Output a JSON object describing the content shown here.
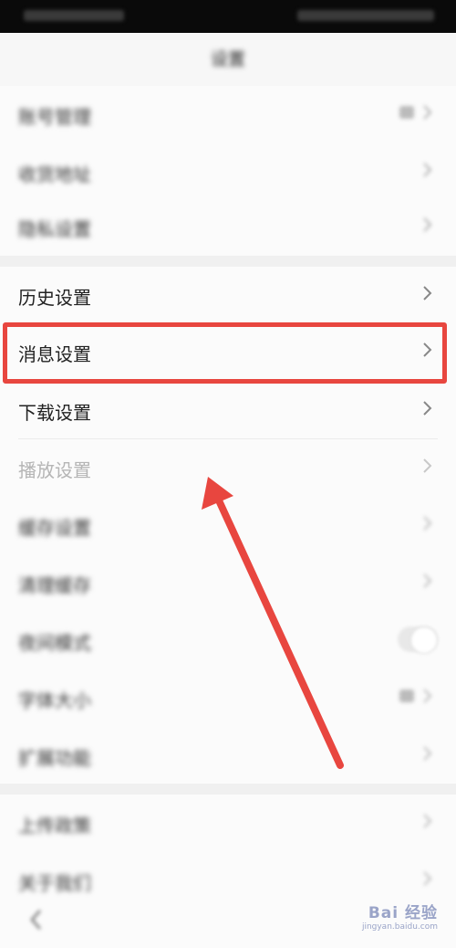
{
  "nav": {
    "title": "设置"
  },
  "rows_top": [
    {
      "label": "账号管理",
      "blurred": true,
      "value": true
    },
    {
      "label": "收货地址",
      "blurred": true
    },
    {
      "label": "隐私设置",
      "blurred": true
    }
  ],
  "rows_main": [
    {
      "label": "历史设置"
    },
    {
      "label": "消息设置",
      "highlighted": true
    },
    {
      "label": "下载设置"
    },
    {
      "label": "播放设置",
      "faded": true
    },
    {
      "label": "缓存设置",
      "blurred": true
    },
    {
      "label": "清理缓存",
      "blurred": true
    },
    {
      "label": "夜间模式",
      "blurred": true,
      "toggle": true
    },
    {
      "label": "字体大小",
      "blurred": true,
      "value": true
    },
    {
      "label": "扩展功能",
      "blurred": true
    }
  ],
  "rows_bottom": [
    {
      "label": "上传政策",
      "blurred": true
    },
    {
      "label": "关于我们",
      "blurred": true
    }
  ],
  "watermark": {
    "main": "Bai 经验",
    "sub": "jingyan.baidu.com"
  },
  "colors": {
    "highlight": "#e8463f",
    "arrow": "#e8463f"
  }
}
